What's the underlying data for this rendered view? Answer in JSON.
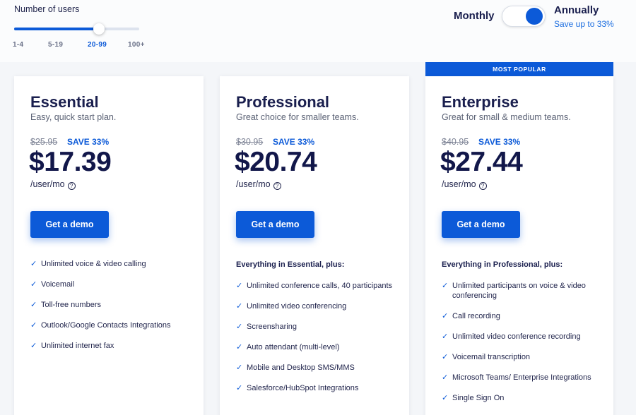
{
  "users": {
    "label": "Number of users",
    "options": [
      "1-4",
      "5-19",
      "20-99",
      "100+"
    ],
    "selected": "20-99",
    "slider_fraction": 0.68
  },
  "billing": {
    "monthly_label": "Monthly",
    "annually_label": "Annually",
    "save_note": "Save up to 33%",
    "selected": "Annually"
  },
  "colors": {
    "accent": "#0c5ad8",
    "heading": "#1a1f4e"
  },
  "plans": [
    {
      "name": "Essential",
      "subtitle": "Easy, quick start plan.",
      "old_price": "$25.95",
      "save": "SAVE 33%",
      "price": "$17.39",
      "unit": "/user/mo",
      "cta": "Get a demo",
      "intro": "",
      "features": [
        "Unlimited voice & video calling",
        "Voicemail",
        "Toll-free numbers",
        "Outlook/Google Contacts Integrations",
        "Unlimited internet fax"
      ]
    },
    {
      "name": "Professional",
      "subtitle": "Great choice for smaller teams.",
      "old_price": "$30.95",
      "save": "SAVE 33%",
      "price": "$20.74",
      "unit": "/user/mo",
      "cta": "Get a demo",
      "intro": "Everything in Essential, plus:",
      "features": [
        "Unlimited conference calls, 40 participants",
        "Unlimited video conferencing",
        "Screensharing",
        "Auto attendant (multi-level)",
        "Mobile and Desktop SMS/MMS",
        "Salesforce/HubSpot Integrations"
      ]
    },
    {
      "name": "Enterprise",
      "badge": "MOST POPULAR",
      "subtitle": "Great for small & medium teams.",
      "old_price": "$40.95",
      "save": "SAVE 33%",
      "price": "$27.44",
      "unit": "/user/mo",
      "cta": "Get a demo",
      "intro": "Everything in Professional, plus:",
      "features": [
        "Unlimited participants on voice & video conferencing",
        "Call recording",
        "Unlimited video conference recording",
        "Voicemail transcription",
        "Microsoft Teams/ Enterprise Integrations",
        "Single Sign On"
      ]
    }
  ]
}
